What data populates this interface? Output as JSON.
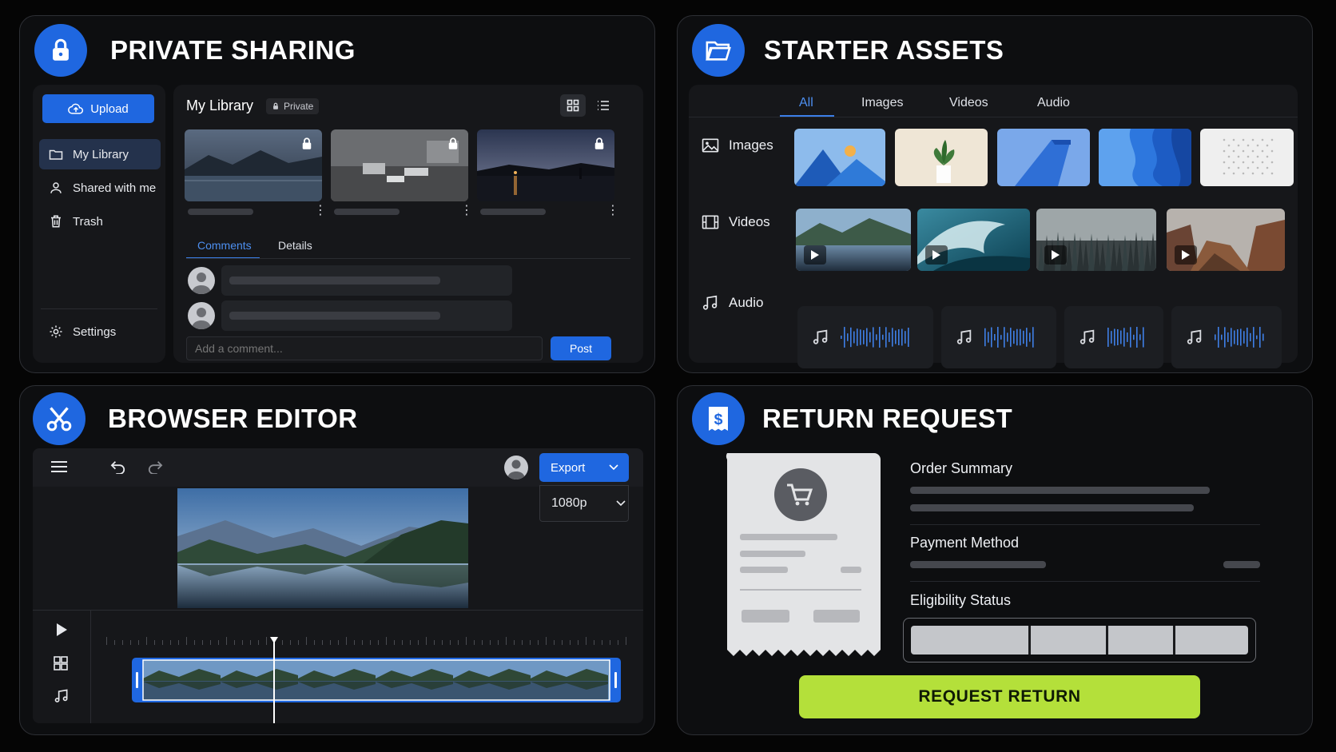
{
  "private_sharing": {
    "title": "PRIVATE SHARING",
    "icon": "lock-icon",
    "upload_label": "Upload",
    "nav": [
      {
        "label": "My Library",
        "icon": "folder-icon",
        "active": true
      },
      {
        "label": "Shared with me",
        "icon": "user-icon",
        "active": false
      },
      {
        "label": "Trash",
        "icon": "trash-icon",
        "active": false
      }
    ],
    "settings_label": "Settings",
    "library_title": "My Library",
    "private_badge": "Private",
    "tabs": [
      "Comments",
      "Details"
    ],
    "comment_placeholder": "Add a comment...",
    "post_label": "Post"
  },
  "starter_assets": {
    "title": "STARTER ASSETS",
    "icon": "folder-open-icon",
    "tabs": [
      "All",
      "Images",
      "Videos",
      "Audio"
    ],
    "active_tab": "All",
    "rows": {
      "images": "Images",
      "videos": "Videos",
      "audio": "Audio"
    }
  },
  "browser_editor": {
    "title": "BROWSER EDITOR",
    "icon": "scissors-icon",
    "export_label": "Export",
    "resolution": "1080p"
  },
  "return_request": {
    "title": "RETURN REQUEST",
    "icon": "receipt-dollar-icon",
    "order_summary": "Order Summary",
    "payment_method": "Payment Method",
    "eligibility_status": "Eligibility Status",
    "request_label": "REQUEST RETURN"
  },
  "colors": {
    "accent": "#1f67e0",
    "cta": "#b4e03a",
    "panel": "#0d0e10"
  }
}
